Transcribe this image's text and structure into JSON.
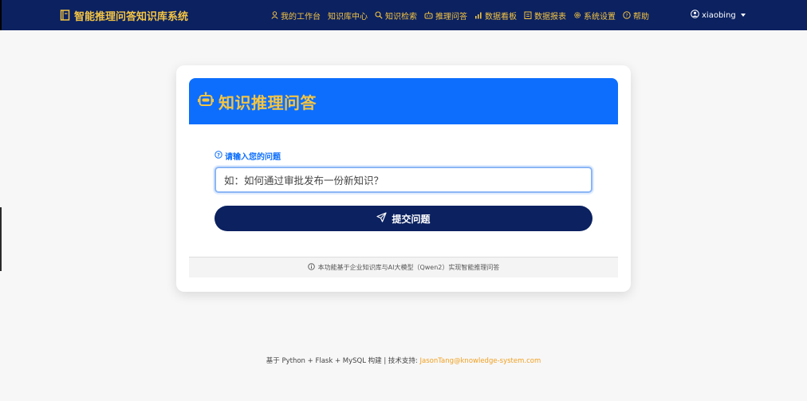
{
  "app": {
    "title": "智能推理问答知识库系统"
  },
  "nav": {
    "items": [
      {
        "label": "我的工作台",
        "icon": "user-icon"
      },
      {
        "label": "知识库中心",
        "icon": ""
      },
      {
        "label": "知识检索",
        "icon": "search-icon"
      },
      {
        "label": "推理问答",
        "icon": "robot-icon"
      },
      {
        "label": "数据看板",
        "icon": "bar-chart-icon"
      },
      {
        "label": "数据报表",
        "icon": "report-icon"
      },
      {
        "label": "系统设置",
        "icon": "gear-icon"
      },
      {
        "label": "帮助",
        "icon": "question-circle-icon"
      }
    ],
    "user": "xiaobing"
  },
  "card": {
    "title": "知识推理问答",
    "question_label": "请输入您的问题",
    "input_placeholder": "如：如何通过审批发布一份新知识？",
    "submit_label": "提交问题",
    "footer_note": "本功能基于企业知识库与AI大模型（Qwen2）实现智能推理问答"
  },
  "page_footer": {
    "text": "基于 Python + Flask + MySQL 构建 | 技术支持: ",
    "email": "JasonTang@knowledge-system.com"
  },
  "colors": {
    "navbar": "#0b2160",
    "accent_yellow": "#f5c542",
    "primary_blue": "#0d6efd",
    "button_navy": "#0b2160"
  }
}
